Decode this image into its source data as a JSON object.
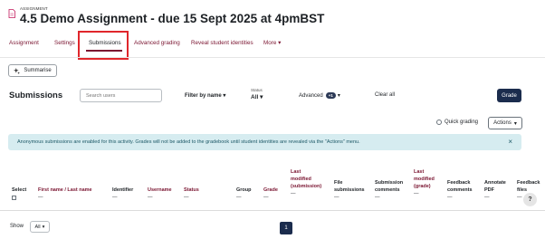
{
  "header": {
    "small_label": "ASSIGNMENT",
    "title": "4.5 Demo Assignment - due 15 Sept 2025 at 4pmBST"
  },
  "tabs": [
    {
      "label": "Assignment",
      "active": false
    },
    {
      "label": "Settings",
      "active": false
    },
    {
      "label": "Submissions",
      "active": true
    },
    {
      "label": "Advanced grading",
      "active": false
    },
    {
      "label": "Reveal student identities",
      "active": false
    },
    {
      "label": "More",
      "active": false
    }
  ],
  "summarise": {
    "label": "Summarise",
    "icon": "sparkle-icon"
  },
  "toolbar": {
    "title": "Submissions",
    "search_placeholder": "Search users",
    "filter_label": "Filter by name",
    "status_label": "Status",
    "status_value": "All",
    "advanced_label": "Advanced",
    "advanced_badge": "+1",
    "clear_all": "Clear all",
    "grade_button": "Grade"
  },
  "options": {
    "quick_grading": "Quick grading",
    "actions": "Actions"
  },
  "alert": {
    "text": "Anonymous submissions are enabled for this activity. Grades will not be added to the gradebook until student identities are revealed via the \"Actions\" menu.",
    "close": "×"
  },
  "table": {
    "headers": [
      {
        "l1": "Select",
        "l2": "",
        "l3": "",
        "link": false
      },
      {
        "l1": "First name / Last name",
        "l2": "",
        "l3": "",
        "link": true
      },
      {
        "l1": "Identifier",
        "l2": "",
        "l3": "",
        "link": false
      },
      {
        "l1": "Username",
        "l2": "",
        "l3": "",
        "link": true
      },
      {
        "l1": "Status",
        "l2": "",
        "l3": "",
        "link": true
      },
      {
        "l1": "Group",
        "l2": "",
        "l3": "",
        "link": false
      },
      {
        "l1": "Grade",
        "l2": "",
        "l3": "",
        "link": true
      },
      {
        "l1": "Last",
        "l2": "modified",
        "l3": "(submission)",
        "link": true
      },
      {
        "l1": "File",
        "l2": "submissions",
        "l3": "",
        "link": false
      },
      {
        "l1": "Submission",
        "l2": "comments",
        "l3": "",
        "link": false
      },
      {
        "l1": "Last",
        "l2": "modified",
        "l3": "(grade)",
        "link": true
      },
      {
        "l1": "Feedback",
        "l2": "comments",
        "l3": "",
        "link": false
      },
      {
        "l1": "Annotate",
        "l2": "PDF",
        "l3": "",
        "link": false
      },
      {
        "l1": "Feedback",
        "l2": "files",
        "l3": "",
        "link": false
      }
    ],
    "dash": "—"
  },
  "footer": {
    "show_label": "Show",
    "show_value": "All",
    "page": "1",
    "help": "?"
  },
  "colors": {
    "accent": "#7a1430",
    "primary_button": "#1b2c4d",
    "alert_bg": "#d6ecf0",
    "highlight_box": "#e0262b"
  }
}
